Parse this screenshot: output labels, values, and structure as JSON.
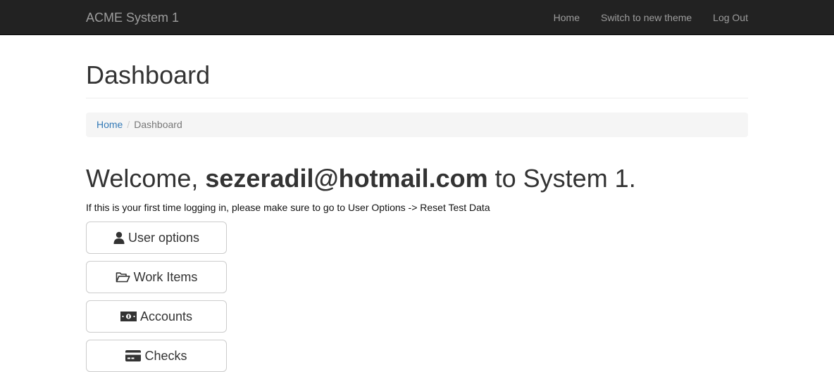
{
  "navbar": {
    "brand": "ACME System 1",
    "links": [
      {
        "label": "Home"
      },
      {
        "label": "Switch to new theme"
      },
      {
        "label": "Log Out"
      }
    ]
  },
  "page": {
    "title": "Dashboard",
    "breadcrumb": {
      "home": "Home",
      "separator": "/",
      "current": "Dashboard"
    },
    "welcome": {
      "prefix": "Welcome, ",
      "user": "sezeradil@hotmail.com",
      "suffix": " to System 1."
    },
    "hint": "If this is your first time logging in, please make sure to go to User Options -> Reset Test Data"
  },
  "buttons": {
    "user_options": {
      "label": "User options",
      "icon": "user-icon"
    },
    "work_items": {
      "label": "Work Items",
      "icon": "folder-open-icon"
    },
    "accounts": {
      "label": "Accounts",
      "icon": "money-icon"
    },
    "checks": {
      "label": "Checks",
      "icon": "credit-card-icon"
    }
  },
  "colors": {
    "navbar_bg": "#222222",
    "navbar_text": "#9d9d9d",
    "link": "#337ab7",
    "breadcrumb_bg": "#f5f5f5"
  }
}
